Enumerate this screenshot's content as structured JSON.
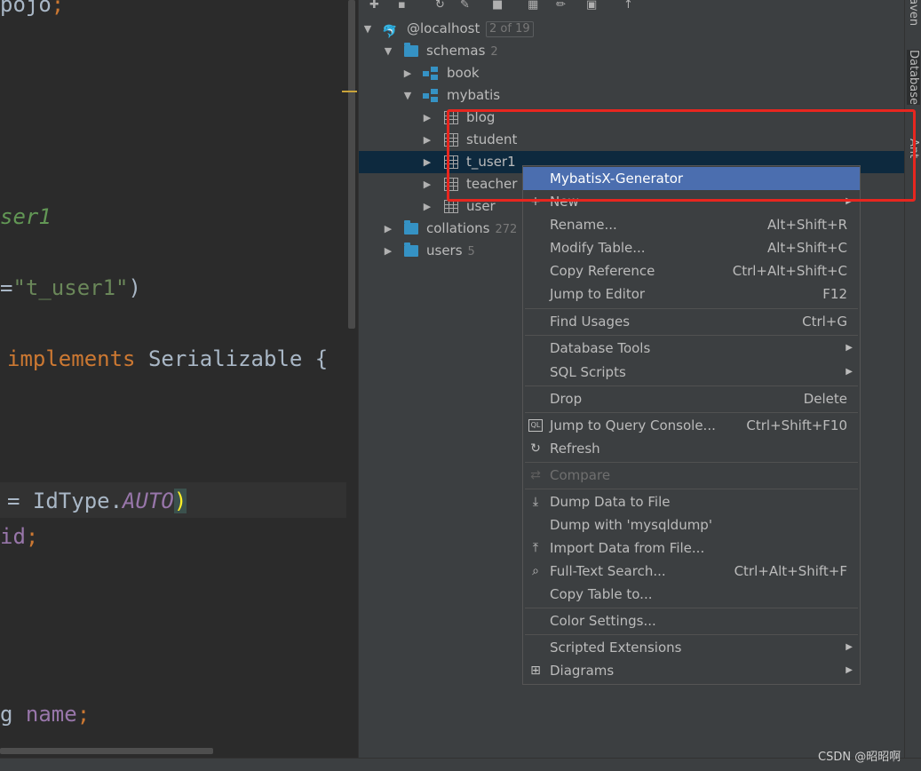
{
  "editor": {
    "lines": {
      "l1": {
        "a": "pojo",
        "b": ";"
      },
      "l2": "ser1",
      "l3": {
        "a": "=",
        "b": "\"t_user1\"",
        "c": ")"
      },
      "l4": {
        "a": "implements",
        "b": " Serializable {"
      },
      "l5": {
        "a": "= IdType.",
        "b": "AUTO",
        "c": ")"
      },
      "l6": {
        "a": "id",
        "b": ";"
      },
      "l7": {
        "a": "g ",
        "b": "name",
        "c": ";"
      }
    }
  },
  "db_tree": {
    "host": {
      "label": "@localhost",
      "badge": "2 of 19"
    },
    "schemas": {
      "label": "schemas",
      "count": "2"
    },
    "book": "book",
    "mybatis": "mybatis",
    "tables": [
      "blog",
      "student",
      "t_user1",
      "teacher",
      "user"
    ],
    "collations": {
      "label": "collations",
      "count": "272"
    },
    "users": {
      "label": "users",
      "count": "5"
    }
  },
  "context_menu": {
    "generator": "MybatisX-Generator",
    "new": "New",
    "rename": {
      "label": "Rename...",
      "shortcut": "Alt+Shift+R"
    },
    "modify_table": {
      "label": "Modify Table...",
      "shortcut": "Alt+Shift+C"
    },
    "copy_reference": {
      "label": "Copy Reference",
      "shortcut": "Ctrl+Alt+Shift+C"
    },
    "jump_to_editor": {
      "label": "Jump to Editor",
      "shortcut": "F12"
    },
    "find_usages": {
      "label": "Find Usages",
      "shortcut": "Ctrl+G"
    },
    "database_tools": "Database Tools",
    "sql_scripts": "SQL Scripts",
    "drop": {
      "label": "Drop",
      "shortcut": "Delete"
    },
    "jump_query_console": {
      "label": "Jump to Query Console...",
      "shortcut": "Ctrl+Shift+F10"
    },
    "refresh": "Refresh",
    "compare": "Compare",
    "dump_data": "Dump Data to File",
    "dump_mysqldump": "Dump with 'mysqldump'",
    "import_data": "Import Data from File...",
    "full_text_search": {
      "label": "Full-Text Search...",
      "shortcut": "Ctrl+Alt+Shift+F"
    },
    "copy_table": "Copy Table to...",
    "color_settings": "Color Settings...",
    "scripted_extensions": "Scripted Extensions",
    "diagrams": "Diagrams"
  },
  "right_tabs": {
    "maven": "Maven",
    "database": "Database",
    "ant": "Ant"
  },
  "watermark": "CSDN @昭昭啊",
  "colors": {
    "accent": "#4b6eaf",
    "annotation": "#e8261f",
    "selection": "#0d293e"
  }
}
